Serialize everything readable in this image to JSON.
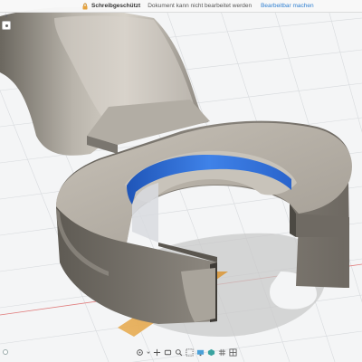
{
  "readonly_bar": {
    "title": "Schreibgeschützt",
    "message": "Dokument kann nicht bearbeitet werden",
    "action": "Bearbeitbar machen"
  },
  "viewport": {
    "model": "wrench-head",
    "grid": true,
    "colors": {
      "body": "#8c8780",
      "highlight_face": "#2f6fd6",
      "shadow": "#d9a14c"
    }
  },
  "navigation": {
    "viewcube_icon": "chevron-down-icon",
    "nav_icon": "home-icon"
  },
  "bottom_toolbar": {
    "tools": [
      "orbit-icon",
      "pan-icon",
      "look-at-icon",
      "zoom-icon",
      "zoom-window-icon",
      "display-settings-icon",
      "visual-style-icon",
      "grid-icon",
      "viewports-icon"
    ]
  }
}
